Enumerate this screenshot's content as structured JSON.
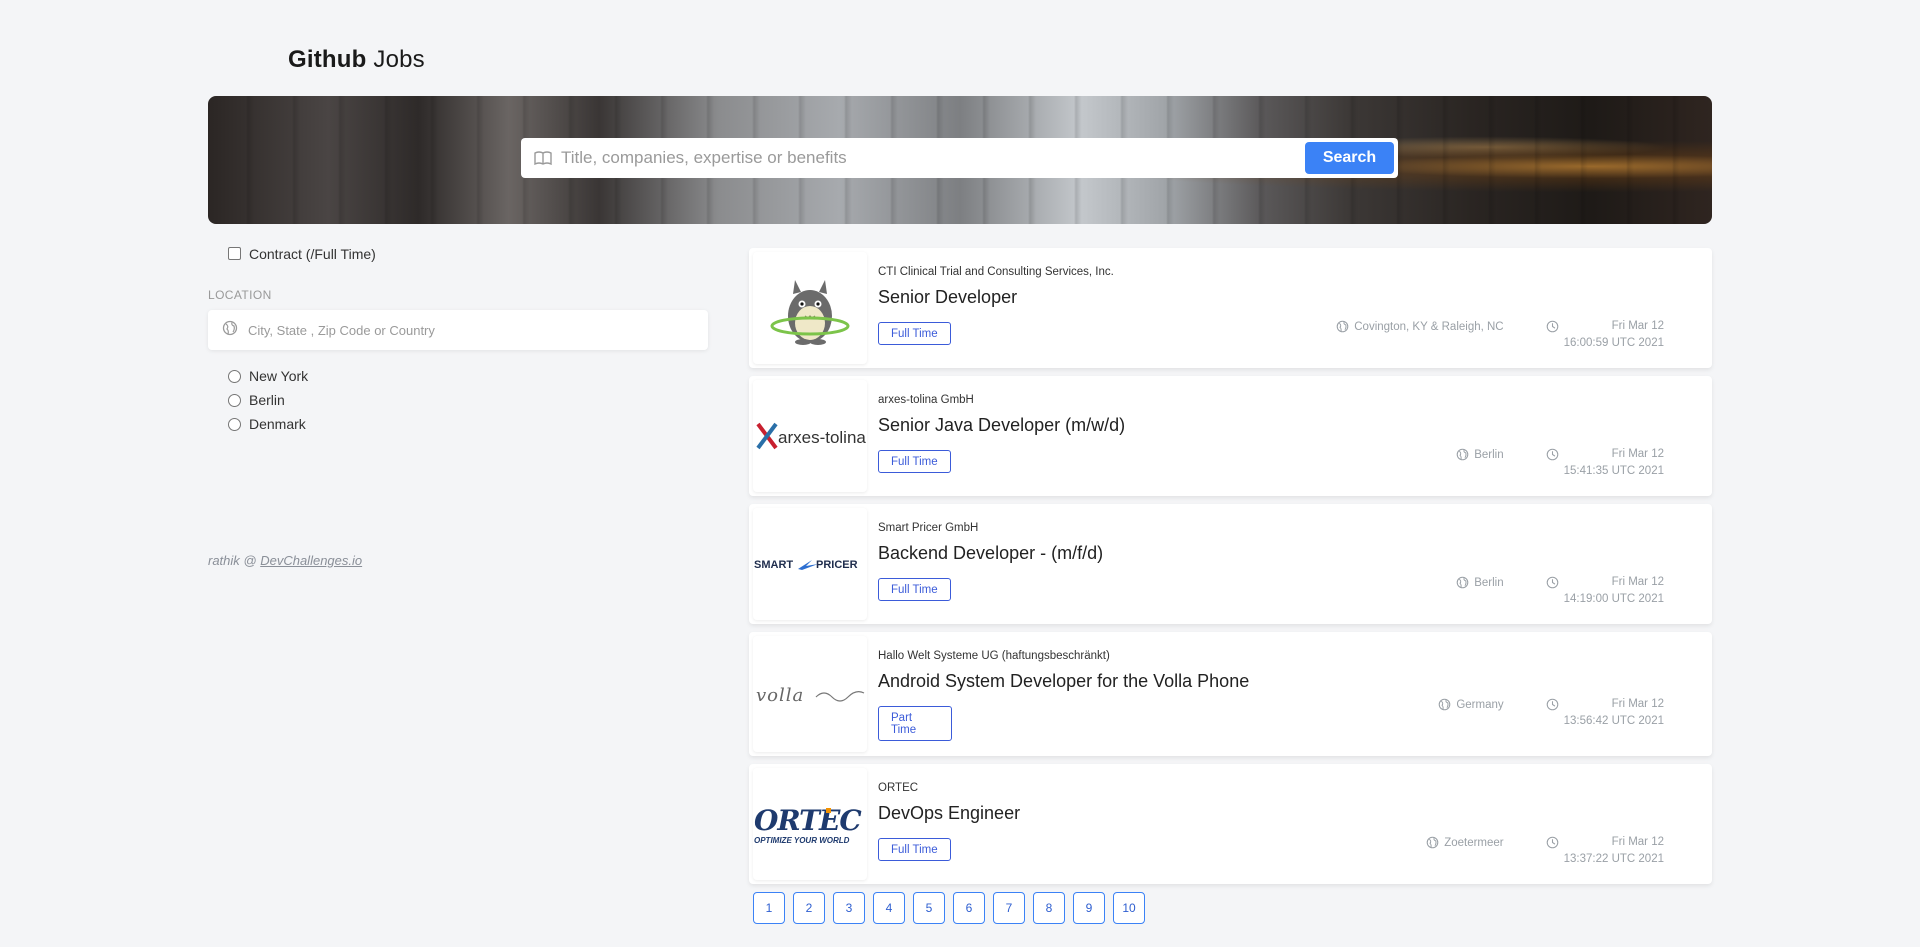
{
  "brand": {
    "bold": "Github",
    "light": " Jobs"
  },
  "search": {
    "placeholder": "Title, companies, expertise or benefits",
    "button_label": "Search"
  },
  "filters": {
    "contract_label": "Contract (/Full Time)",
    "location_label": "LOCATION",
    "location_placeholder": "City, State , Zip Code or Country",
    "locations": [
      "New York",
      "Berlin",
      "Denmark"
    ]
  },
  "footer": {
    "prefix": "rathik @ ",
    "link": "DevChallenges.io"
  },
  "jobs": [
    {
      "company": "CTI Clinical Trial and Consulting Services, Inc.",
      "title": "Senior Developer",
      "type": "Full Time",
      "location": "Covington, KY & Raleigh, NC",
      "date_line1": "Fri Mar 12",
      "date_line2": "16:00:59 UTC 2021"
    },
    {
      "company": "arxes-tolina GmbH",
      "title": "Senior Java Developer (m/w/d)",
      "type": "Full Time",
      "location": "Berlin",
      "date_line1": "Fri Mar 12",
      "date_line2": "15:41:35 UTC 2021"
    },
    {
      "company": "Smart Pricer GmbH",
      "title": "Backend Developer - (m/f/d)",
      "type": "Full Time",
      "location": "Berlin",
      "date_line1": "Fri Mar 12",
      "date_line2": "14:19:00 UTC 2021"
    },
    {
      "company": "Hallo Welt Systeme UG (haftungsbeschränkt)",
      "title": "Android System Developer for the Volla Phone",
      "type_line1": "Part",
      "type_line2": "Time",
      "location": "Germany",
      "date_line1": "Fri Mar 12",
      "date_line2": "13:56:42 UTC 2021"
    },
    {
      "company": "ORTEC",
      "title": "DevOps Engineer",
      "type": "Full Time",
      "location": "Zoetermeer",
      "date_line1": "Fri Mar 12",
      "date_line2": "13:37:22 UTC 2021"
    }
  ],
  "logos": {
    "arxes": "arxes-tolina",
    "smart_left": "SMART",
    "smart_right": "PRICER",
    "volla": "volla",
    "ortec": "ORTEC",
    "ortec_tagline": "OPTIMIZE YOUR WORLD"
  },
  "pagination": [
    "1",
    "2",
    "3",
    "4",
    "5",
    "6",
    "7",
    "8",
    "9",
    "10"
  ]
}
